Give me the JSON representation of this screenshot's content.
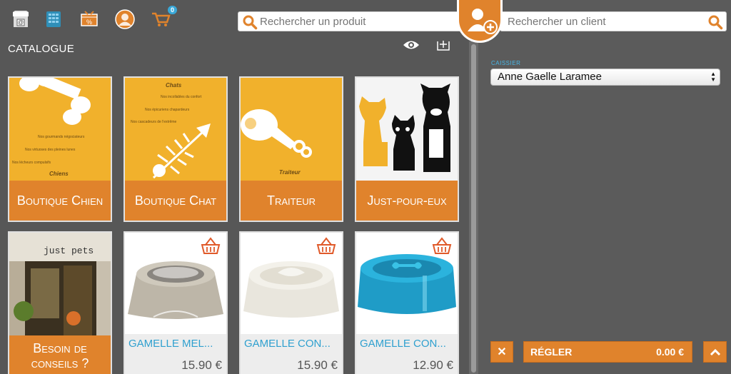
{
  "toolbar": {
    "icons": [
      "store-icon",
      "register-icon",
      "discount-icon",
      "user-icon",
      "cart-icon"
    ],
    "cart_count": "0"
  },
  "search": {
    "product_placeholder": "Rechercher un produit",
    "client_placeholder": "Rechercher un client"
  },
  "catalog": {
    "title": "CATALOGUE",
    "categories": [
      {
        "label": "Boutique Chien",
        "art_lines": [
          "Nos gourmands négociateurs",
          "Nos virtuoses des pleines lunes",
          "Nos lécheurs compulsifs"
        ],
        "art_caption": "Chiens"
      },
      {
        "label": "Boutique Chat",
        "art_title": "Chats",
        "art_lines": [
          "Nos incollables du confort",
          "Nos épicuriens chapardeurs",
          "Nos cascadeurs de l'extrême"
        ]
      },
      {
        "label": "Traiteur",
        "art_caption": "Traiteur"
      },
      {
        "label": "Just-pour-eux"
      }
    ],
    "row2": [
      {
        "label": "Besoin de conseils ?",
        "sign": "just pets"
      },
      {
        "name": "GAMELLE MEL...",
        "price": "15.90 €"
      },
      {
        "name": "GAMELLE CON...",
        "price": "15.90 €"
      },
      {
        "name": "GAMELLE CON...",
        "price": "12.90 €"
      }
    ]
  },
  "cashier": {
    "label": "CAISSIER",
    "selected": "Anne Gaelle Laramee"
  },
  "actions": {
    "cancel": "✕",
    "pay_label": "RÉGLER",
    "pay_amount": "0.00 €"
  },
  "colors": {
    "accent": "#e0832c",
    "tile_yellow": "#f1b12c",
    "link_blue": "#2fa0cf",
    "background": "#575757"
  }
}
